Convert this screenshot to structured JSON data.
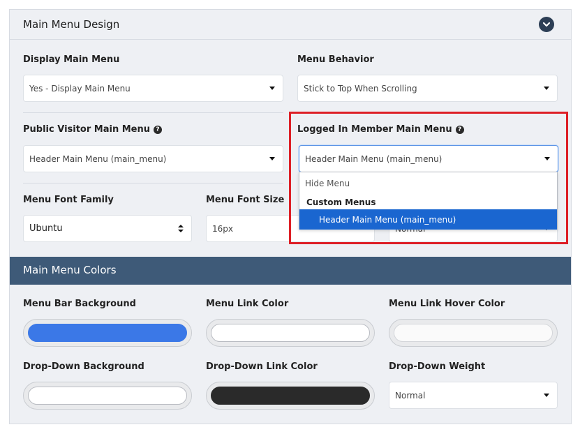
{
  "panel": {
    "title": "Main Menu Design",
    "collapse_icon": "chevron-down-icon"
  },
  "fields": {
    "display_main_menu": {
      "label": "Display Main Menu",
      "value": "Yes - Display Main Menu"
    },
    "menu_behavior": {
      "label": "Menu Behavior",
      "value": "Stick to Top When Scrolling"
    },
    "public_visitor_main_menu": {
      "label": "Public Visitor Main Menu",
      "value": "Header Main Menu (main_menu)",
      "help_icon": "question-circle-icon"
    },
    "logged_in_member_main_menu": {
      "label": "Logged In Member Main Menu",
      "value": "Header Main Menu (main_menu)",
      "help_icon": "question-circle-icon"
    },
    "menu_font_family": {
      "label": "Menu Font Family",
      "value": "Ubuntu"
    },
    "menu_font_size": {
      "label": "Menu Font Size",
      "value": "16px"
    },
    "menu_font_weight": {
      "value": "Normal"
    }
  },
  "dropdown": {
    "hide_option": "Hide Menu",
    "group_label": "Custom Menus",
    "selected_option": "Header Main Menu (main_menu)"
  },
  "colors_section": {
    "title": "Main Menu Colors",
    "menu_bar_background": {
      "label": "Menu Bar Background",
      "color": "#3b78e7"
    },
    "menu_link_color": {
      "label": "Menu Link Color",
      "color": "#ffffff"
    },
    "menu_link_hover_color": {
      "label": "Menu Link Hover Color",
      "color": "#fafafa"
    },
    "dropdown_background": {
      "label": "Drop-Down Background",
      "color": "#ffffff"
    },
    "dropdown_link_color": {
      "label": "Drop-Down Link Color",
      "color": "#2a2a2a"
    },
    "dropdown_weight": {
      "label": "Drop-Down Weight",
      "value": "Normal"
    }
  },
  "theme": {
    "accent": "#1a66d0",
    "header_bar": "#3e5a78",
    "highlight": "#dd1f26"
  }
}
